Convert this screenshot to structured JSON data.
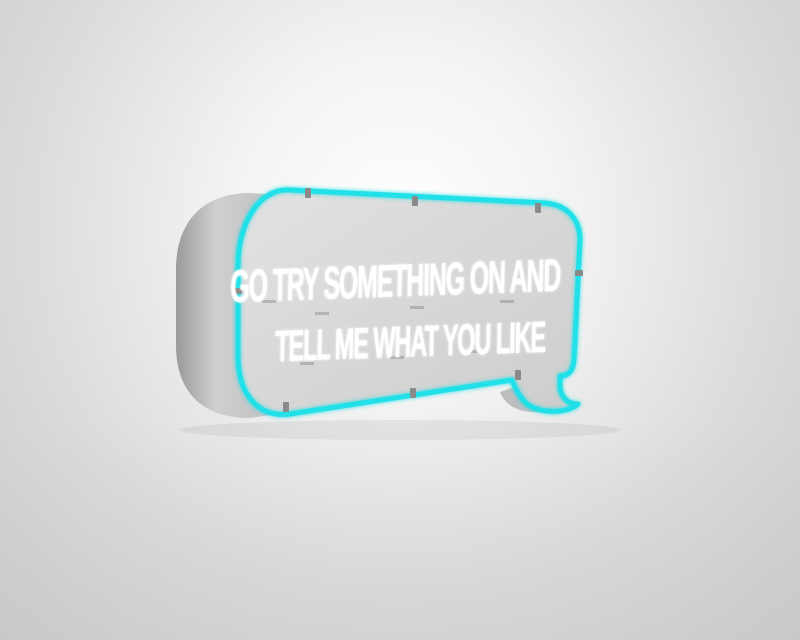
{
  "sign": {
    "line1": "GO TRY SOMETHING ON AND",
    "line2": "TELL ME WHAT YOU LIKE",
    "neon_outline_color": "#22e0e8",
    "text_color": "#ffffff",
    "panel_color": "#d6d6d6",
    "shape": "speech-bubble"
  }
}
